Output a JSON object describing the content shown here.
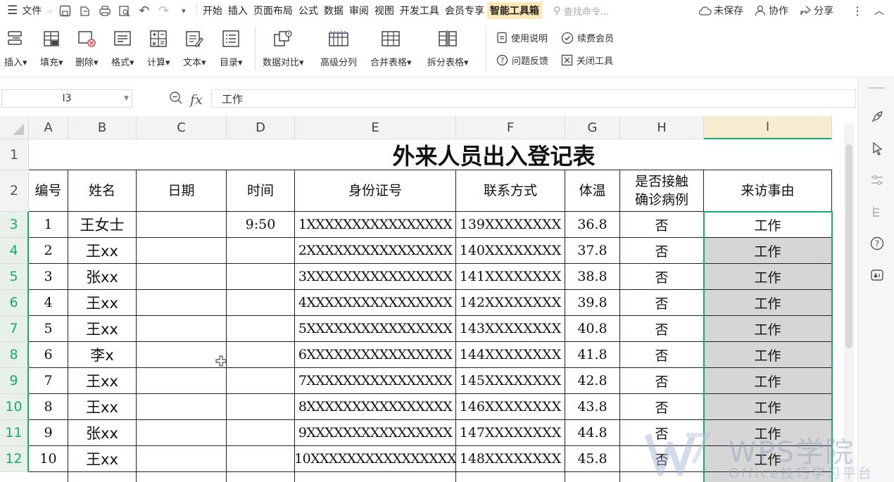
{
  "menubar": {
    "file_label": "文件",
    "tabs": [
      "开始",
      "插入",
      "页面布局",
      "公式",
      "数据",
      "审阅",
      "视图",
      "开发工具",
      "会员专享",
      "智能工具箱"
    ],
    "active_tab": "智能工具箱",
    "search_placeholder": "查找命令...",
    "unsaved": "未保存",
    "collab": "协作",
    "share": "分享"
  },
  "ribbon": {
    "buttons": [
      {
        "label": "插入",
        "icon": "insert-icon"
      },
      {
        "label": "填充",
        "icon": "fill-icon"
      },
      {
        "label": "删除",
        "icon": "delete-icon"
      },
      {
        "label": "格式",
        "icon": "format-icon"
      },
      {
        "label": "计算",
        "icon": "calculate-icon"
      },
      {
        "label": "文本",
        "icon": "text-icon"
      },
      {
        "label": "目录",
        "icon": "catalog-icon"
      },
      {
        "label": "数据对比",
        "icon": "compare-icon"
      },
      {
        "label": "高级分列",
        "icon": "split-column-icon"
      },
      {
        "label": "合并表格",
        "icon": "merge-table-icon"
      },
      {
        "label": "拆分表格",
        "icon": "split-table-icon"
      }
    ],
    "small": {
      "help": "使用说明",
      "renew": "续费会员",
      "feedback": "问题反馈",
      "close": "关闭工具"
    }
  },
  "formula_bar": {
    "cell_ref": "I3",
    "value": "工作"
  },
  "columns": [
    "A",
    "B",
    "C",
    "D",
    "E",
    "F",
    "G",
    "H",
    "I"
  ],
  "rows": [
    "1",
    "2",
    "3",
    "4",
    "5",
    "6",
    "7",
    "8",
    "9",
    "10",
    "11",
    "12"
  ],
  "sheet": {
    "title": "外来人员出入登记表",
    "headers": [
      "编号",
      "姓名",
      "日期",
      "时间",
      "身份证号",
      "联系方式",
      "体温",
      "是否接触确诊病例",
      "来访事由"
    ],
    "data": [
      [
        "1",
        "王女士",
        "",
        "9:50",
        "1XXXXXXXXXXXXXXXX",
        "139XXXXXXXX",
        "36.8",
        "否",
        "工作"
      ],
      [
        "2",
        "王xx",
        "",
        "",
        "2XXXXXXXXXXXXXXXX",
        "140XXXXXXXX",
        "37.8",
        "否",
        "工作"
      ],
      [
        "3",
        "张xx",
        "",
        "",
        "3XXXXXXXXXXXXXXXX",
        "141XXXXXXXX",
        "38.8",
        "否",
        "工作"
      ],
      [
        "4",
        "王xx",
        "",
        "",
        "4XXXXXXXXXXXXXXXX",
        "142XXXXXXXX",
        "39.8",
        "否",
        "工作"
      ],
      [
        "5",
        "王xx",
        "",
        "",
        "5XXXXXXXXXXXXXXXX",
        "143XXXXXXXX",
        "40.8",
        "否",
        "工作"
      ],
      [
        "6",
        "李x",
        "",
        "",
        "6XXXXXXXXXXXXXXXX",
        "144XXXXXXXX",
        "41.8",
        "否",
        "工作"
      ],
      [
        "7",
        "王xx",
        "",
        "",
        "7XXXXXXXXXXXXXXXX",
        "145XXXXXXXX",
        "42.8",
        "否",
        "工作"
      ],
      [
        "8",
        "王xx",
        "",
        "",
        "8XXXXXXXXXXXXXXXX",
        "146XXXXXXXX",
        "43.8",
        "否",
        "工作"
      ],
      [
        "9",
        "张xx",
        "",
        "",
        "9XXXXXXXXXXXXXXXX",
        "147XXXXXXXX",
        "44.8",
        "否",
        "工作"
      ],
      [
        "10",
        "王xx",
        "",
        "",
        "10XXXXXXXXXXXXXXXX",
        "148XXXXXXXX",
        "45.8",
        "否",
        "工作"
      ]
    ]
  },
  "watermark": {
    "brand": "WPS学院",
    "tagline": "Office技巧学习平台"
  },
  "colors": {
    "selection": "#1aa86b",
    "active_tab_bg": "#fde9b8",
    "shaded_cell": "#d6d6d6"
  }
}
